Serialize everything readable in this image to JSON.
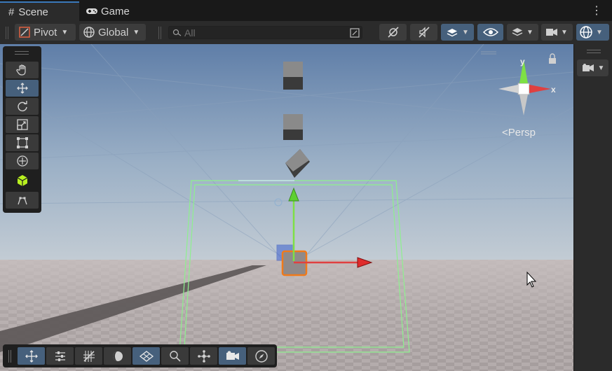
{
  "tabs": [
    {
      "label": "Scene",
      "icon": "hash-icon"
    },
    {
      "label": "Game",
      "icon": "gamepad-icon"
    }
  ],
  "toolbar": {
    "pivot_label": "Pivot",
    "global_label": "Global",
    "search_placeholder": "All"
  },
  "gizmo": {
    "persp_label": "Persp",
    "y_label": "y",
    "x_label": "x"
  },
  "colors": {
    "accent": "#46607c",
    "x_axis": "#e02c2c",
    "y_axis": "#7ee045",
    "z_axis": "#3a5fd0",
    "bounds": "#8ef08e",
    "selection": "#f07a1a"
  }
}
